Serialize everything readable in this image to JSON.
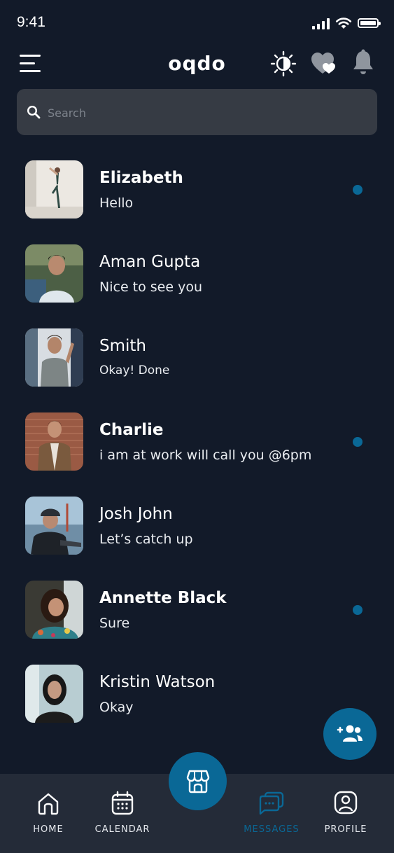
{
  "status_bar": {
    "time": "9:41"
  },
  "header": {
    "title": "oqdo"
  },
  "search": {
    "placeholder": "Search"
  },
  "chats": [
    {
      "name": "Elizabeth",
      "message": "Hello",
      "unread": true
    },
    {
      "name": "Aman Gupta",
      "message": "Nice to see you",
      "unread": false
    },
    {
      "name": "Smith",
      "message": "Okay! Done",
      "unread": false
    },
    {
      "name": "Charlie",
      "message": "i am at work will call you @6pm",
      "unread": true
    },
    {
      "name": "Josh John",
      "message": "Let’s catch up",
      "unread": false
    },
    {
      "name": "Annette Black",
      "message": "Sure",
      "unread": true
    },
    {
      "name": "Kristin Watson",
      "message": "Okay",
      "unread": false
    }
  ],
  "bottom_nav": {
    "items": [
      {
        "label": "HOME",
        "icon": "home-icon"
      },
      {
        "label": "CALENDAR",
        "icon": "calendar-icon"
      },
      {
        "label": "MESSAGES",
        "icon": "messages-icon",
        "active": true
      },
      {
        "label": "PROFILE",
        "icon": "profile-icon"
      }
    ],
    "center_icon": "store-icon"
  },
  "colors": {
    "background": "#121a29",
    "accent": "#0a6896",
    "search_bg": "#363b44",
    "nav_bg": "#242b38"
  }
}
